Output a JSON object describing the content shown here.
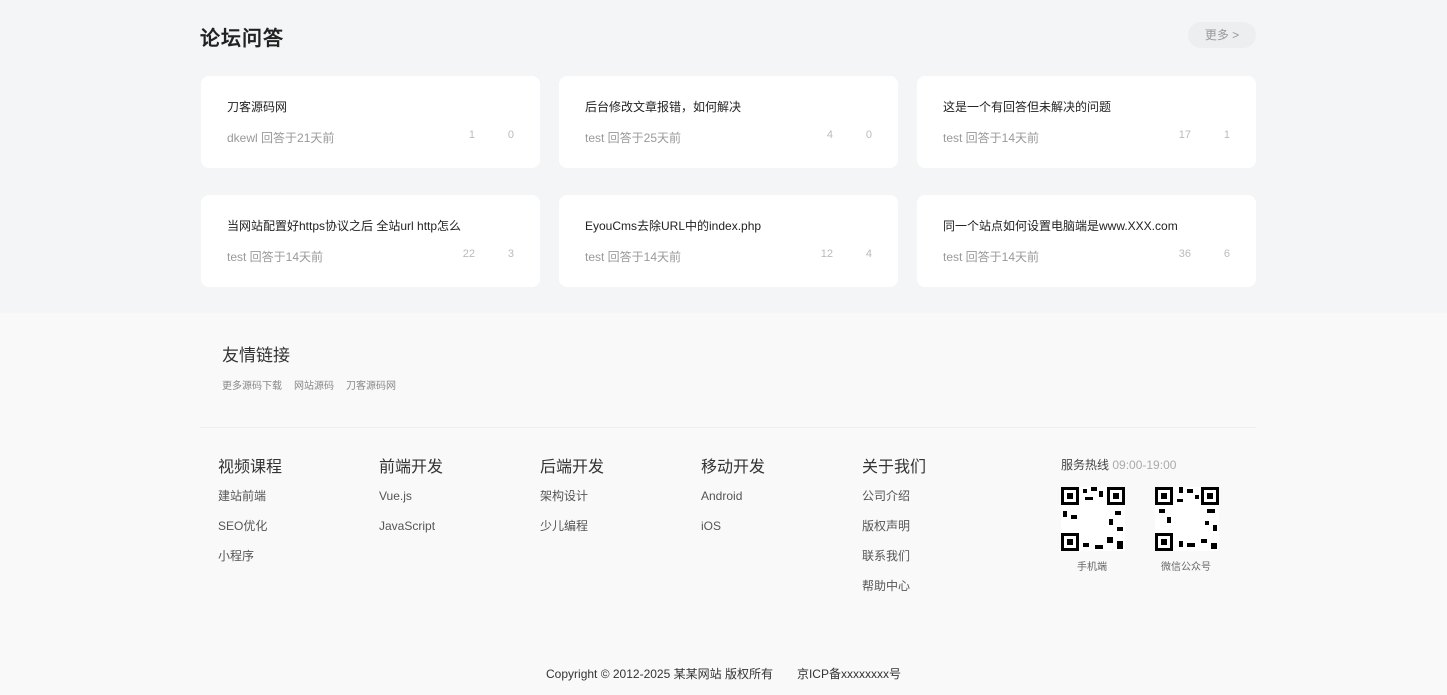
{
  "qa": {
    "title": "论坛问答",
    "more": "更多 >",
    "cards": [
      {
        "question": "刀客源码网",
        "meta": "dkewl 回答于21天前",
        "n1": "1",
        "n2": "0"
      },
      {
        "question": "后台修改文章报错，如何解决",
        "meta": "test 回答于25天前",
        "n1": "4",
        "n2": "0"
      },
      {
        "question": "这是一个有回答但未解决的问题",
        "meta": "test 回答于14天前",
        "n1": "17",
        "n2": "1"
      },
      {
        "question": "当网站配置好https协议之后 全站url http怎么",
        "meta": "test 回答于14天前",
        "n1": "22",
        "n2": "3"
      },
      {
        "question": "EyouCms去除URL中的index.php",
        "meta": "test 回答于14天前",
        "n1": "12",
        "n2": "4"
      },
      {
        "question": "同一个站点如何设置电脑端是www.XXX.com",
        "meta": "test 回答于14天前",
        "n1": "36",
        "n2": "6"
      }
    ]
  },
  "friend_links": {
    "title": "友情链接",
    "items": [
      "更多源码下载",
      "网站源码",
      "刀客源码网"
    ]
  },
  "footer_cols": [
    {
      "title": "视频课程",
      "items": [
        "建站前端",
        "SEO优化",
        "小程序"
      ]
    },
    {
      "title": "前端开发",
      "items": [
        "Vue.js",
        "JavaScript"
      ]
    },
    {
      "title": "后端开发",
      "items": [
        "架构设计",
        "少儿编程"
      ]
    },
    {
      "title": "移动开发",
      "items": [
        "Android",
        "iOS"
      ]
    },
    {
      "title": "关于我们",
      "items": [
        "公司介绍",
        "版权声明",
        "联系我们",
        "帮助中心"
      ]
    }
  ],
  "service": {
    "label": "服务热线",
    "time": "09:00-19:00",
    "qr_labels": [
      "手机端",
      "微信公众号"
    ]
  },
  "copyright": {
    "text": "Copyright © 2012-2025 某某网站 版权所有",
    "icp": "京ICP备xxxxxxxx号"
  }
}
